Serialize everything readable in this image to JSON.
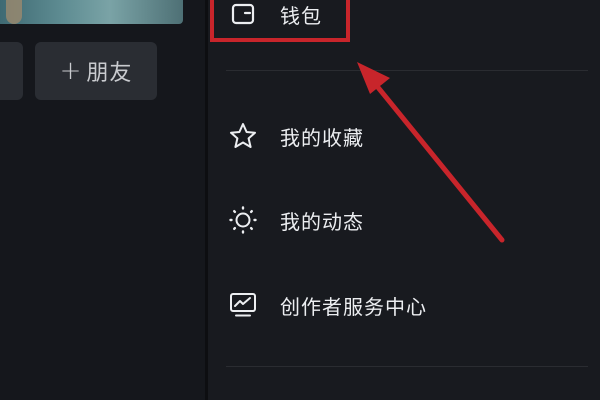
{
  "profile": {
    "add_friend_label": "朋友",
    "add_friend_plus": "+"
  },
  "menu": {
    "items": [
      {
        "label": "钱包",
        "icon": "wallet-icon"
      },
      {
        "label": "我的收藏",
        "icon": "star-icon"
      },
      {
        "label": "我的动态",
        "icon": "sun-icon"
      },
      {
        "label": "创作者服务中心",
        "icon": "chart-monitor-icon"
      }
    ]
  },
  "annotation": {
    "color": "#c8252b"
  }
}
